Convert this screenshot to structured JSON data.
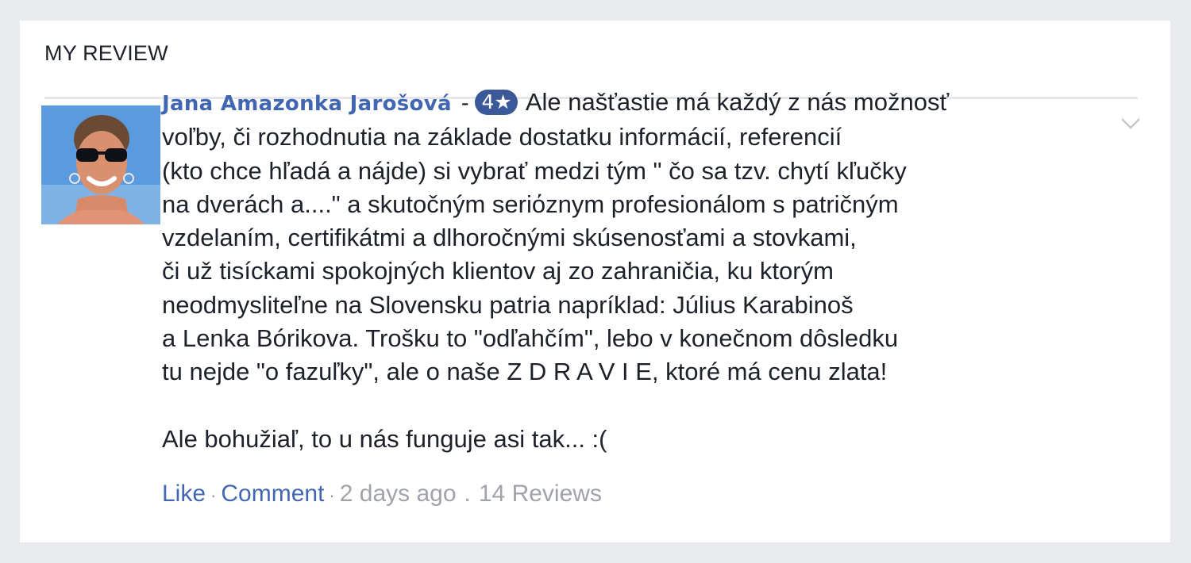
{
  "header": {
    "title": "MY REVIEW"
  },
  "review": {
    "author": "Jana Amazonka Jarošová",
    "separator": "-",
    "rating": "4★",
    "lines": [
      "Ale našťastie má každý z nás možnosť",
      "voľby, či rozhodnutia na základe dostatku informácií, referencií",
      "(kto chce hľadá a nájde) si vybrať medzi tým \" čo sa tzv. chytí kľučky",
      "na dverách a....\" a skutočným seriόznym profesionálom s patričným",
      "vzdelaním, certifikátmi a dlhoročnými skúsenosťami a stovkami,",
      "či už tisíckami spokojných klientov aj zo zahraničia, ku ktorým",
      "neodmysliteľne na Slovensku patria napríklad: Július Karabinoš",
      "a Lenka Bórikova. Trošku to \"odľahčím\", lebo v konečnom dôsledku",
      "tu nejde \"o fazuľky\", ale o naše Z D R A V I E, ktoré má cenu zlata!"
    ],
    "closing": "Ale bohužiaľ, to u nás funguje asi tak... :(",
    "avatar_icon": "profile-photo"
  },
  "actions": {
    "like": "Like",
    "comment": "Comment",
    "dot": "·",
    "time": "2 days ago",
    "dot2": ".",
    "reviews": "14 Reviews"
  },
  "colors": {
    "page_bg": "#e9eaee",
    "card_bg": "#ffffff",
    "link": "#4267b2",
    "author": "#365899",
    "badge": "#3b5998",
    "muted": "#a0a3a9"
  }
}
